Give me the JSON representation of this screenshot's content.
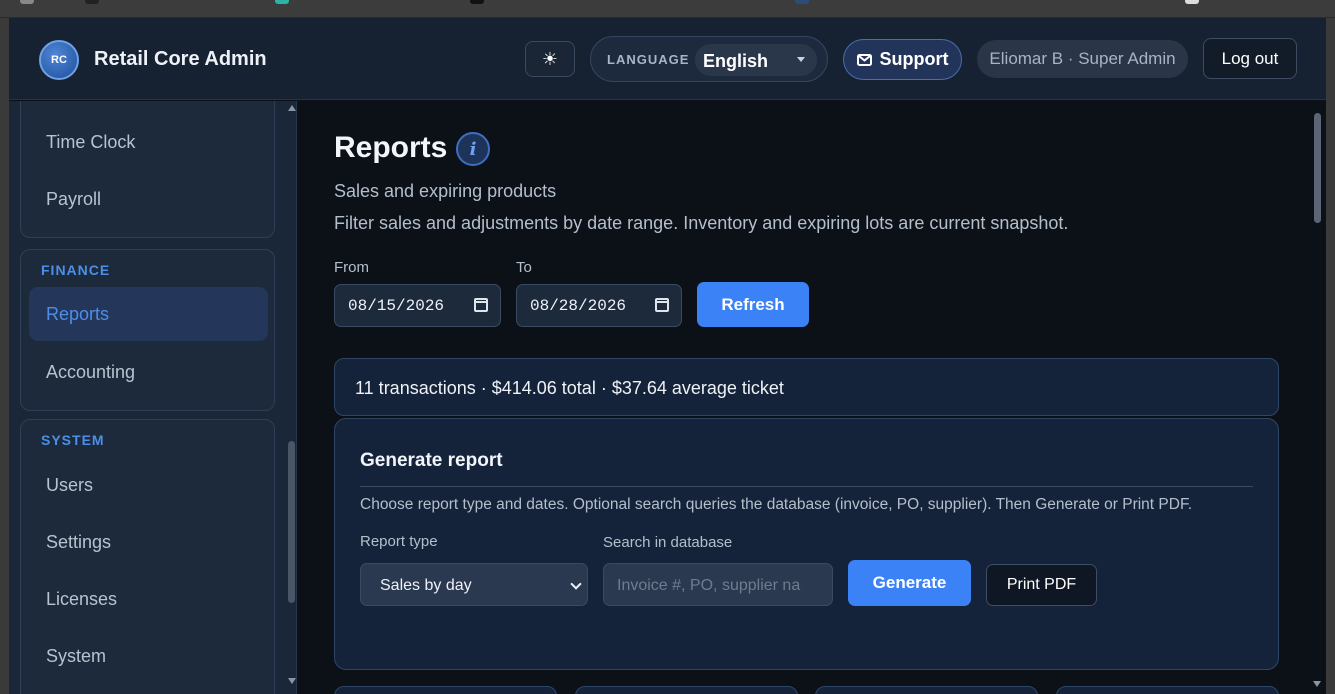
{
  "app": {
    "title": "Retail Core Admin",
    "logo_text": "RC"
  },
  "header": {
    "theme_icon": "sun-icon",
    "language_label": "LANGUAGE",
    "language_value": "English",
    "support_label": "Support",
    "support_icon": "mail-icon",
    "user_label": "Eliomar B · Super Admin",
    "logout_label": "Log out"
  },
  "sidebar": {
    "hr_items": [
      "Time Clock",
      "Payroll"
    ],
    "finance_head": "FINANCE",
    "finance_items": [
      "Reports",
      "Accounting"
    ],
    "active_item": "Reports",
    "system_head": "SYSTEM",
    "system_items": [
      "Users",
      "Settings",
      "Licenses",
      "System"
    ]
  },
  "page": {
    "title": "Reports",
    "info_icon": "i",
    "subtitle": "Sales and expiring products",
    "description": "Filter sales and adjustments by date range. Inventory and expiring lots are current snapshot.",
    "from_label": "From",
    "from_value": "08/15/2026",
    "to_label": "To",
    "to_value": "08/28/2026",
    "refresh_label": "Refresh",
    "summary": "11 transactions · $414.06 total · $37.64 average ticket"
  },
  "generate": {
    "title": "Generate report",
    "description": "Choose report type and dates. Optional search queries the database (invoice, PO, supplier). Then Generate or Print PDF.",
    "report_type_label": "Report type",
    "report_type_value": "Sales by day",
    "search_label": "Search in database",
    "search_placeholder": "Invoice #, PO, supplier na",
    "generate_label": "Generate",
    "print_label": "Print PDF"
  },
  "colors": {
    "accent": "#3b82f6",
    "bg": "#0c1118",
    "panel": "#15233a",
    "sidebar": "#1a2738"
  }
}
